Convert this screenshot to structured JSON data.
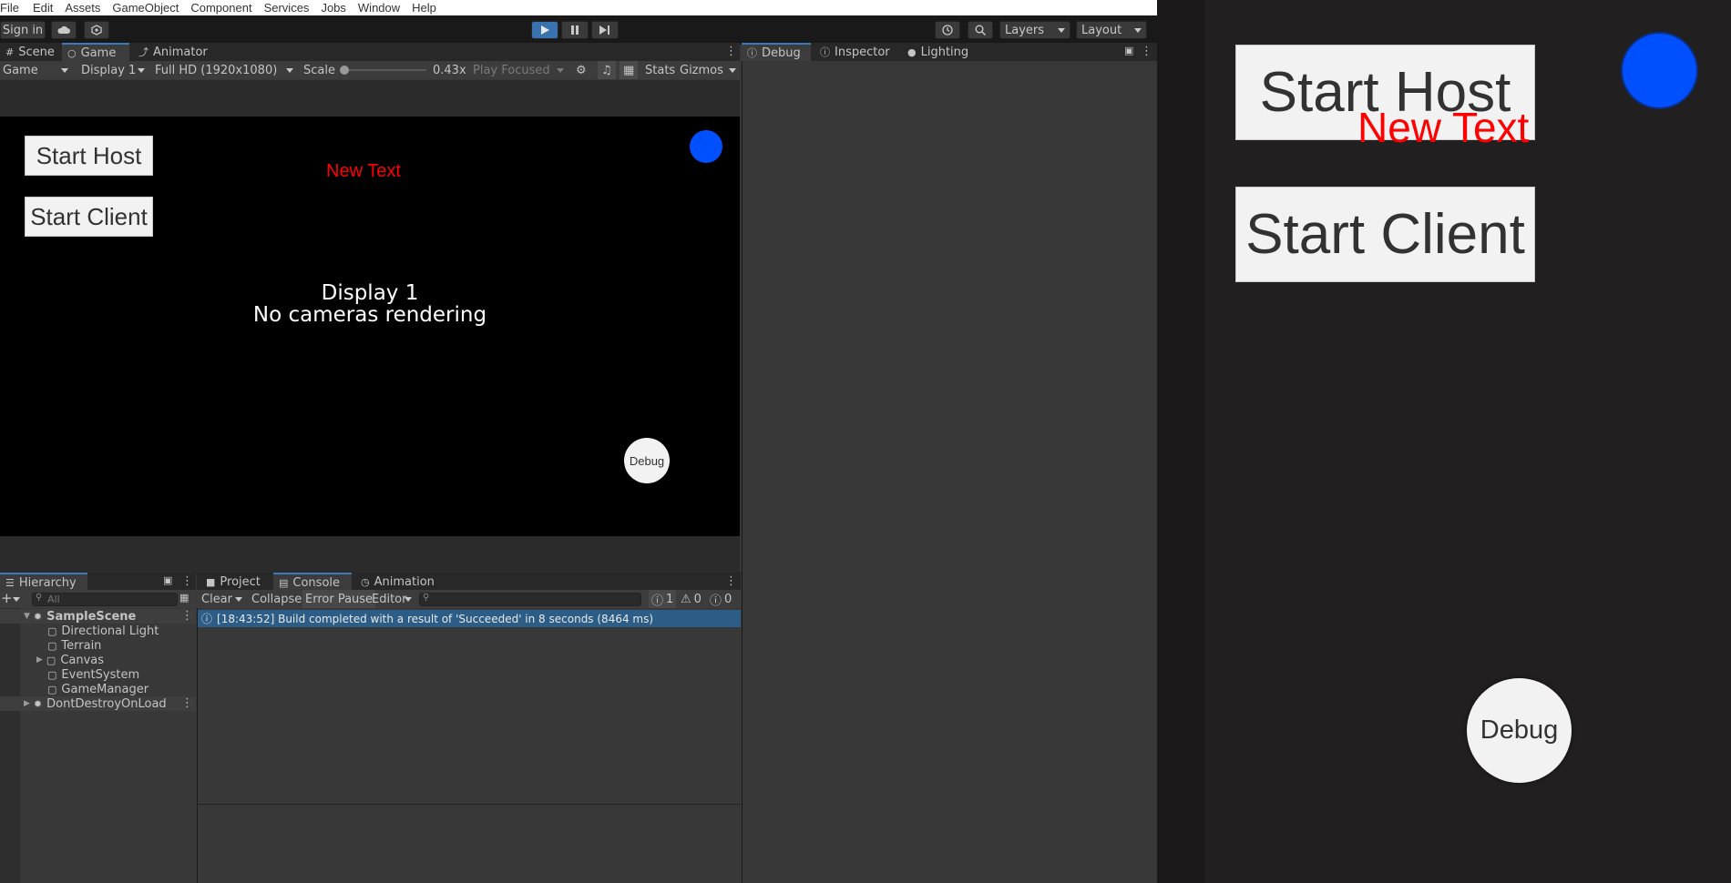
{
  "menubar": [
    "File",
    "Edit",
    "Assets",
    "GameObject",
    "Component",
    "Services",
    "Jobs",
    "Window",
    "Help"
  ],
  "toolbar": {
    "sign_in": "Sign in",
    "cloud_icon": "cloud-icon",
    "collab_icon": "collab-icon",
    "play_icon": "play-icon",
    "pause_icon": "pause-icon",
    "step_icon": "step-icon",
    "history_icon": "history-icon",
    "search_icon": "search-icon",
    "layers": "Layers",
    "layout": "Layout",
    "accent_color": "#3a72b0"
  },
  "editor_tabs": {
    "scene": "Scene",
    "game": "Game",
    "animator": "Animator"
  },
  "game_toolbar": {
    "view": "Game",
    "display": "Display 1",
    "resolution": "Full HD (1920x1080)",
    "scale_label": "Scale",
    "scale_value": "0.43x",
    "play_focused": "Play Focused",
    "stats": "Stats",
    "gizmos": "Gizmos"
  },
  "game_view": {
    "start_host": "Start Host",
    "start_client": "Start Client",
    "new_text": "New Text",
    "debug": "Debug",
    "message_line1": "Display 1",
    "message_line2": "No cameras rendering",
    "text_color": "#ff0000",
    "dot_color": "#0050ff"
  },
  "right_tabs": {
    "debug": "Debug",
    "inspector": "Inspector",
    "lighting": "Lighting"
  },
  "hierarchy": {
    "tab": "Hierarchy",
    "search_placeholder": "All",
    "scene": "SampleScene",
    "items": [
      "Directional Light",
      "Terrain",
      "Canvas",
      "EventSystem",
      "GameManager"
    ],
    "ddol": "DontDestroyOnLoad"
  },
  "console": {
    "tabs": [
      "Project",
      "Console",
      "Animation"
    ],
    "clear": "Clear",
    "collapse": "Collapse",
    "error_pause": "Error Pause",
    "editor": "Editor",
    "count_info": "1",
    "count_warn": "0",
    "count_error": "0",
    "log": "[18:43:52] Build completed with a result of 'Succeeded' in 8 seconds (8464 ms)",
    "log_color": "#2c5d87"
  },
  "player": {
    "start_host": "Start Host",
    "start_client": "Start Client",
    "new_text": "New Text",
    "debug": "Debug"
  }
}
